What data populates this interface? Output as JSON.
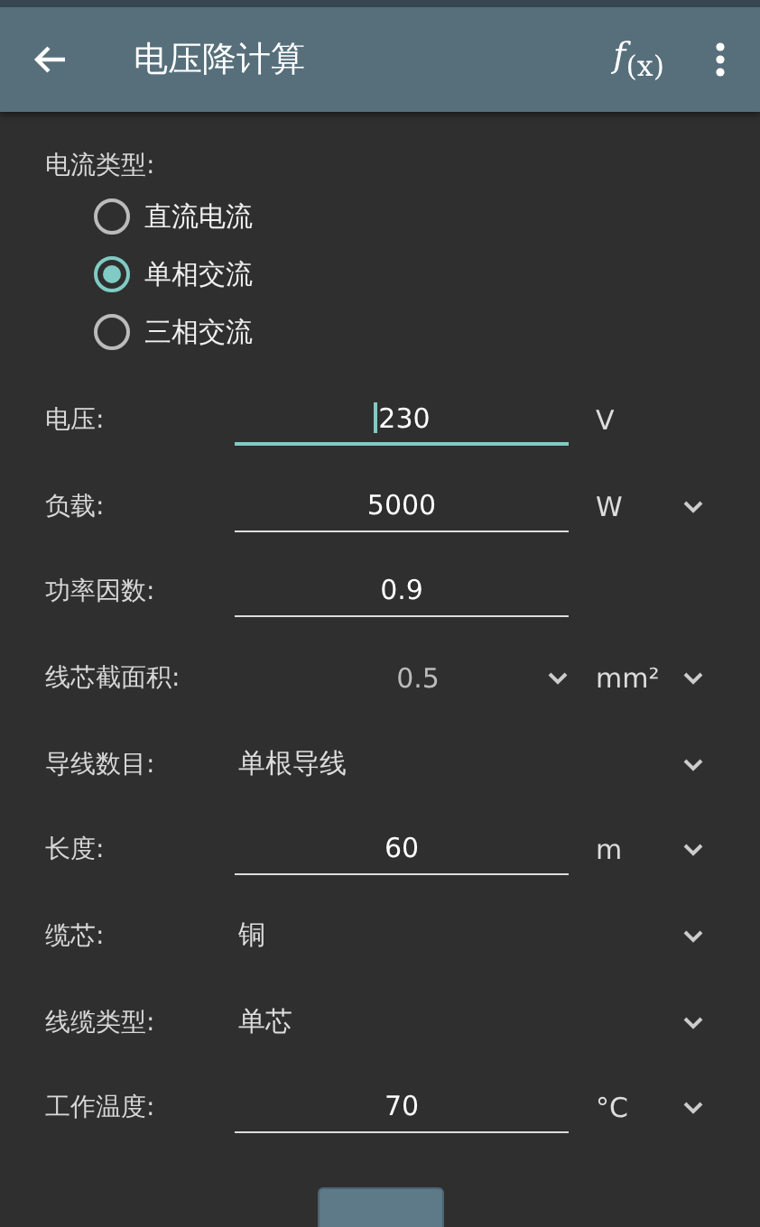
{
  "app_bar": {
    "title": "电压降计算",
    "formula_button": "*f*$_{(x)}$"
  },
  "current_type": {
    "label": "电流类型:",
    "options": [
      {
        "label": "直流电流",
        "selected": false
      },
      {
        "label": "单相交流",
        "selected": true
      },
      {
        "label": "三相交流",
        "selected": false
      }
    ]
  },
  "rows": [
    {
      "kind": "input",
      "label": "电压:",
      "value": "230",
      "focused": true,
      "unit": "V",
      "unit_dropdown": false
    },
    {
      "kind": "input",
      "label": "负载:",
      "value": "5000",
      "focused": false,
      "unit": "W",
      "unit_dropdown": true
    },
    {
      "kind": "input",
      "label": "功率因数:",
      "value": "0.9",
      "focused": false
    },
    {
      "kind": "select_unit",
      "label": "线芯截面积:",
      "value": "0.5",
      "unit": "mm²",
      "unit_dropdown": true
    },
    {
      "kind": "select",
      "label": "导线数目:",
      "value": "单根导线"
    },
    {
      "kind": "input",
      "label": "长度:",
      "value": "60",
      "focused": false,
      "unit": "m",
      "unit_dropdown": true
    },
    {
      "kind": "select",
      "label": "缆芯:",
      "value": "铜"
    },
    {
      "kind": "select",
      "label": "线缆类型:",
      "value": "单芯"
    },
    {
      "kind": "input",
      "label": "工作温度:",
      "value": "70",
      "focused": false,
      "unit": "°C",
      "unit_dropdown": true
    }
  ]
}
